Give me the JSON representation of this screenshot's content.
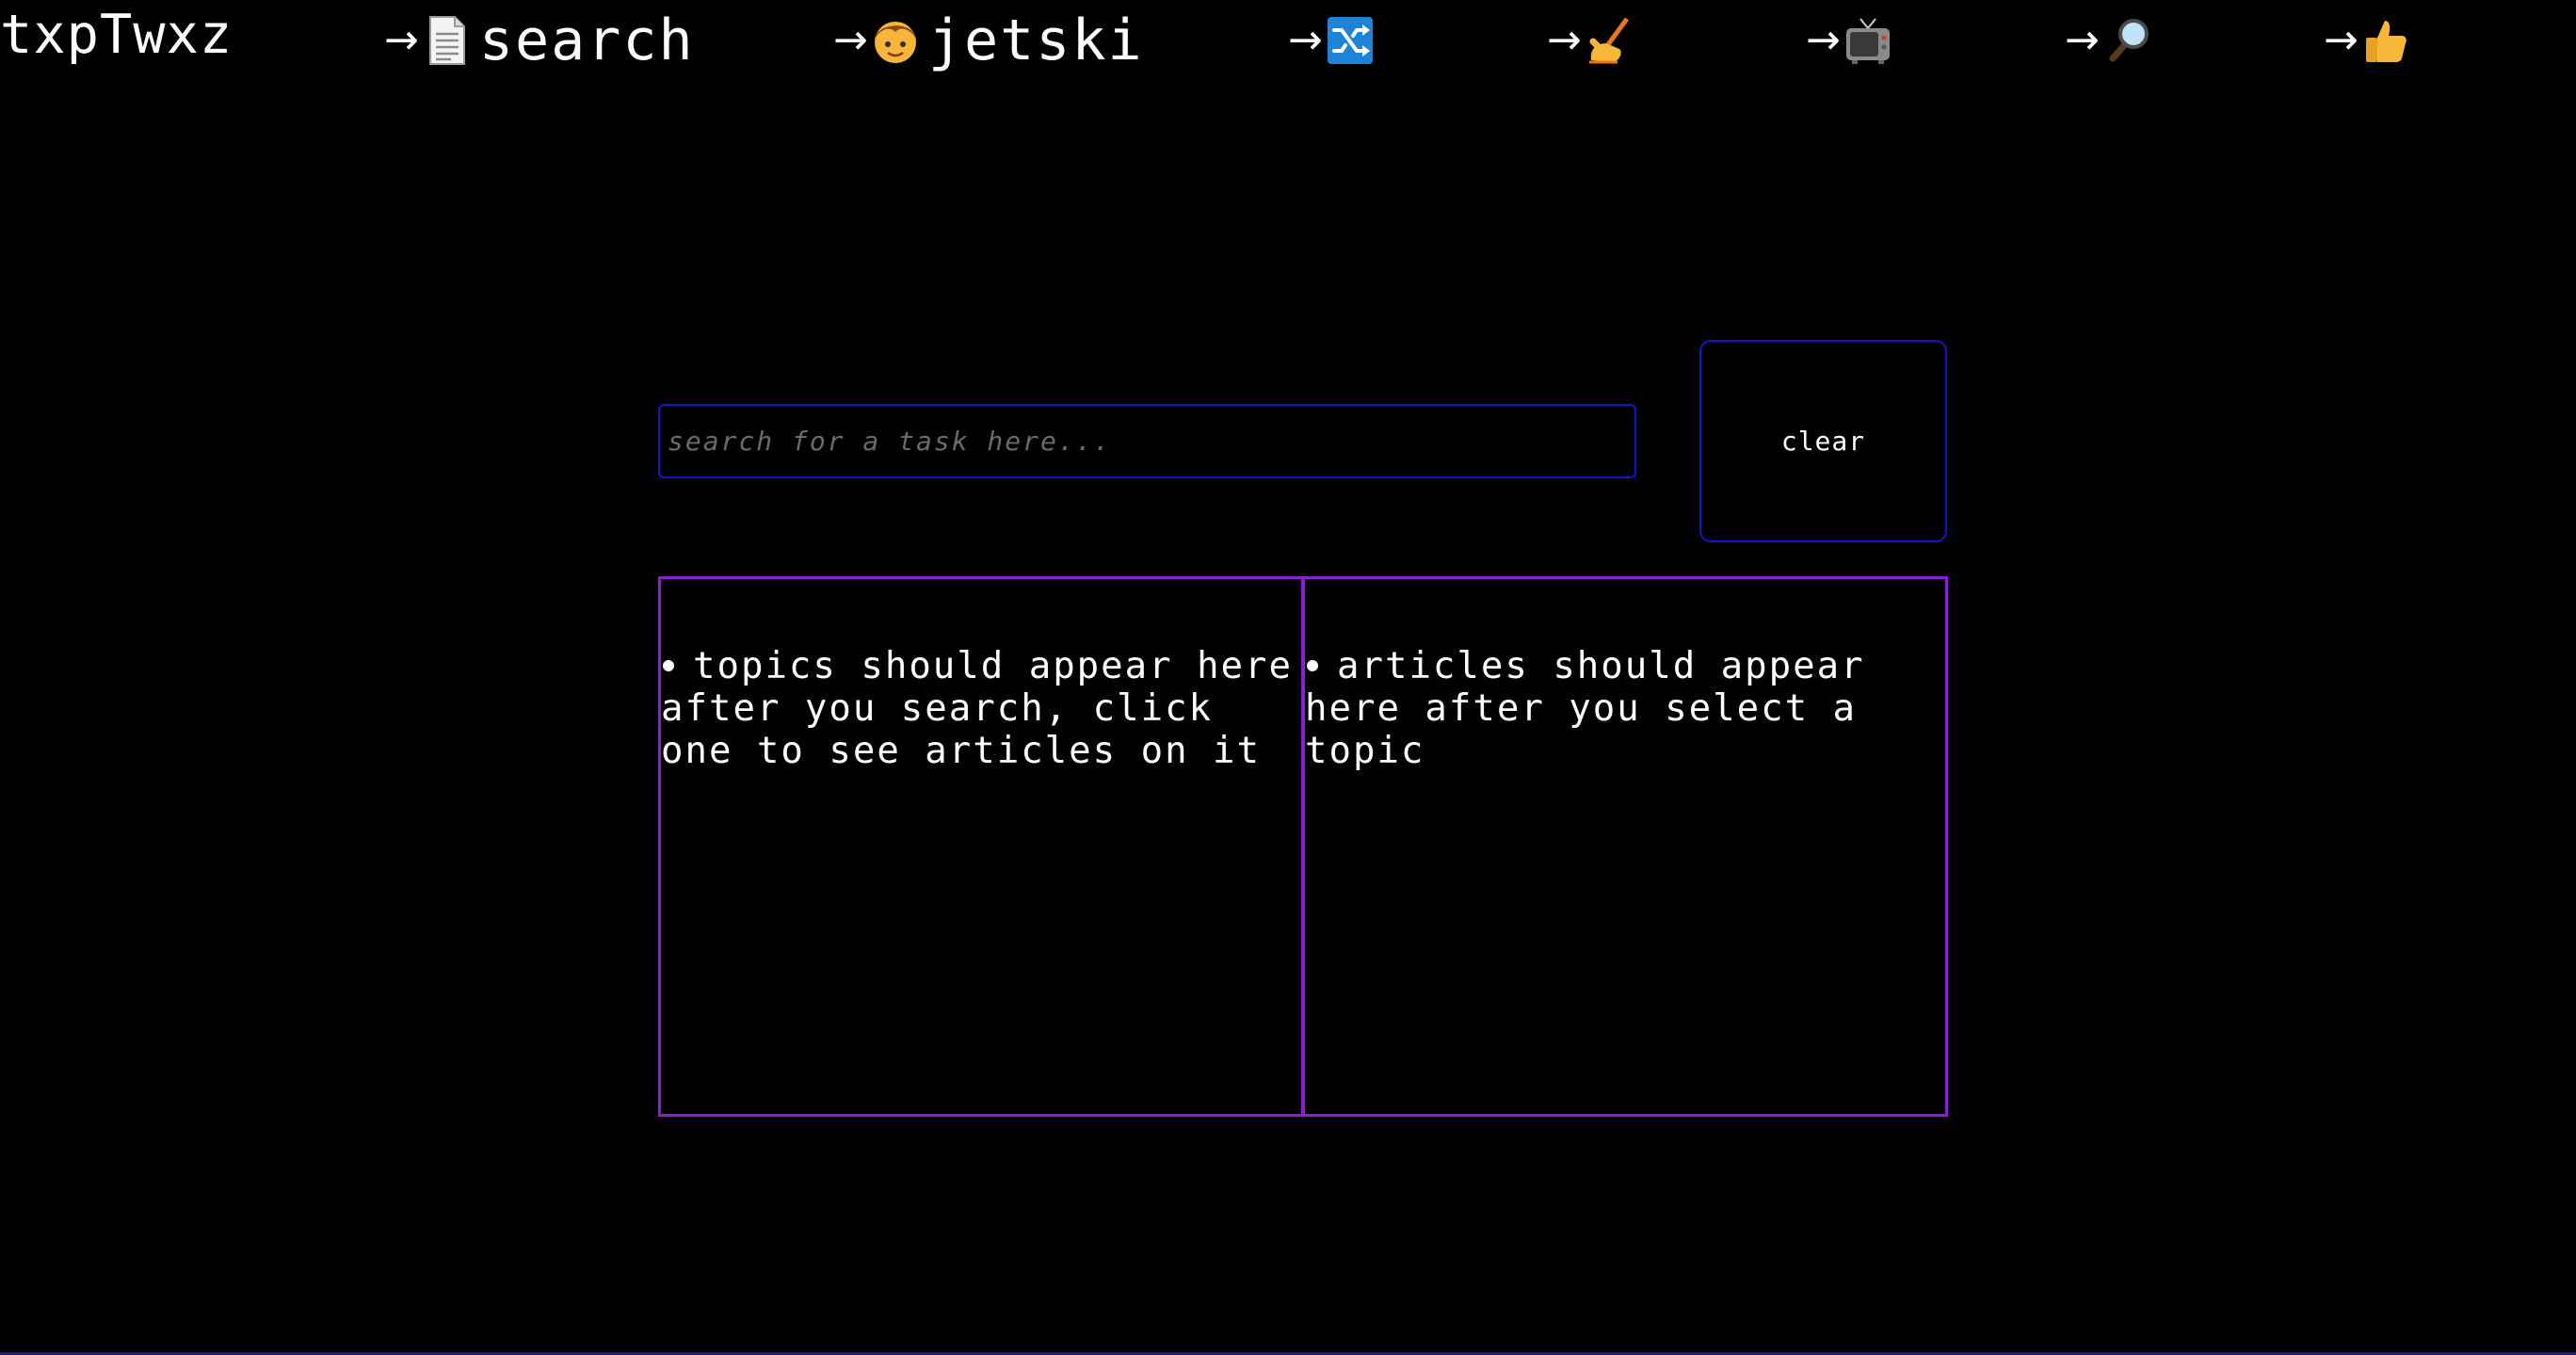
{
  "nav": {
    "brand": "txpTwxz",
    "arrow": "→",
    "items": [
      {
        "icon": "document-icon",
        "label": "search"
      },
      {
        "icon": "boy-face-icon",
        "label": "jetski"
      },
      {
        "icon": "shuffle-icon",
        "label": ""
      },
      {
        "icon": "writing-hand-icon",
        "label": ""
      },
      {
        "icon": "television-icon",
        "label": ""
      },
      {
        "icon": "magnifying-glass-icon",
        "label": ""
      },
      {
        "icon": "thumbs-up-icon",
        "label": ""
      }
    ]
  },
  "search": {
    "placeholder": "search for a task here...",
    "value": "",
    "clear_label": "clear"
  },
  "topics": {
    "items": [
      "topics should appear here after you search, click one to see articles on it"
    ]
  },
  "articles": {
    "items": [
      "articles should appear here after you select a topic"
    ]
  },
  "colors": {
    "background": "#000000",
    "input_border": "#1a12c9",
    "panel_border": "#8a1fd8",
    "text": "#ffffff",
    "placeholder": "#6a6a6a"
  }
}
